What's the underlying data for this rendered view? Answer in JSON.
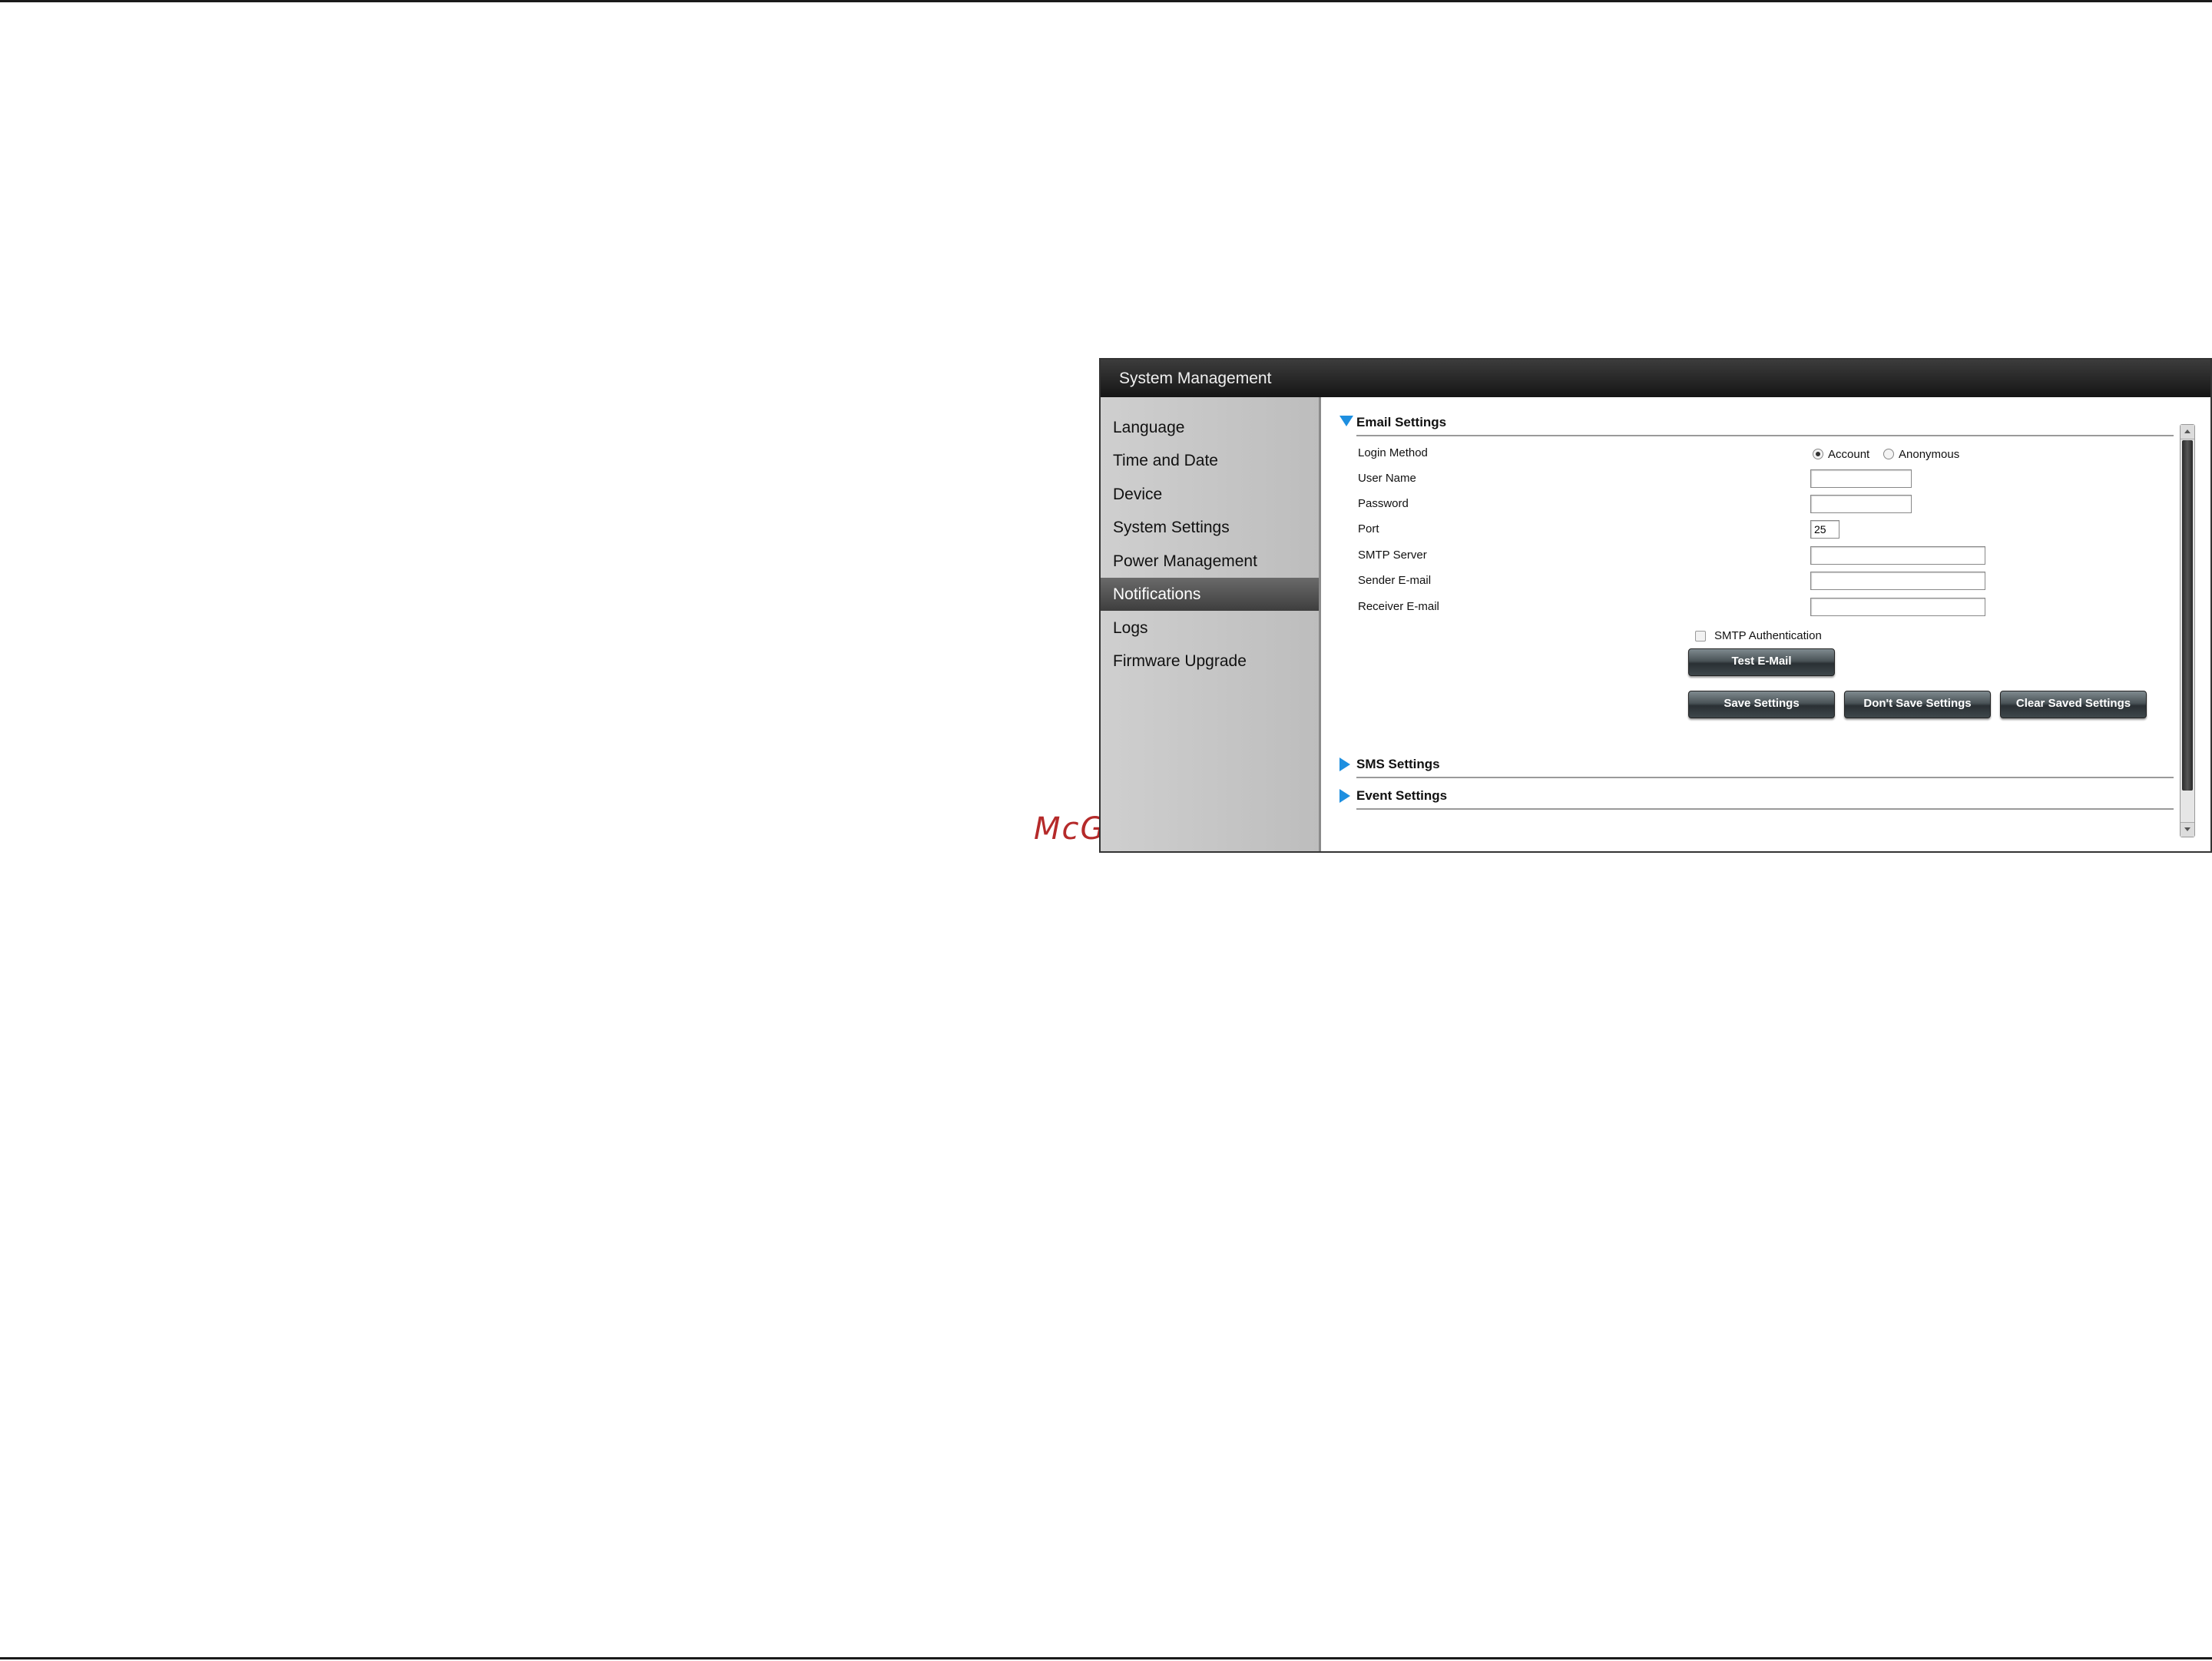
{
  "watermark": "McGrp.Ru",
  "window": {
    "title": "System Management"
  },
  "sidebar": {
    "items": [
      {
        "label": "Language"
      },
      {
        "label": "Time and Date"
      },
      {
        "label": "Device"
      },
      {
        "label": "System Settings"
      },
      {
        "label": "Power Management"
      },
      {
        "label": "Notifications",
        "active": true
      },
      {
        "label": "Logs"
      },
      {
        "label": "Firmware Upgrade"
      }
    ]
  },
  "email": {
    "title": "Email Settings",
    "expanded": true,
    "login_method_label": "Login Method",
    "login_options": [
      {
        "label": "Account",
        "selected": true
      },
      {
        "label": "Anonymous",
        "selected": false
      }
    ],
    "user_name_label": "User Name",
    "user_name_value": "",
    "password_label": "Password",
    "password_value": "",
    "port_label": "Port",
    "port_value": "25",
    "smtp_server_label": "SMTP Server",
    "smtp_server_value": "",
    "sender_label": "Sender E-mail",
    "sender_value": "",
    "receiver_label": "Receiver E-mail",
    "receiver_value": "",
    "smtp_auth_label": "SMTP Authentication",
    "smtp_auth_checked": false,
    "test_button": "Test E-Mail",
    "save_button": "Save Settings",
    "dont_save_button": "Don't Save Settings",
    "clear_button": "Clear Saved Settings"
  },
  "sms": {
    "title": "SMS Settings",
    "expanded": false
  },
  "events": {
    "title": "Event Settings",
    "expanded": false
  },
  "colors": {
    "accent_triangle": "#1e8fe0",
    "title_bar": "#1f1f1f",
    "active_nav": "#4a4a4a"
  }
}
